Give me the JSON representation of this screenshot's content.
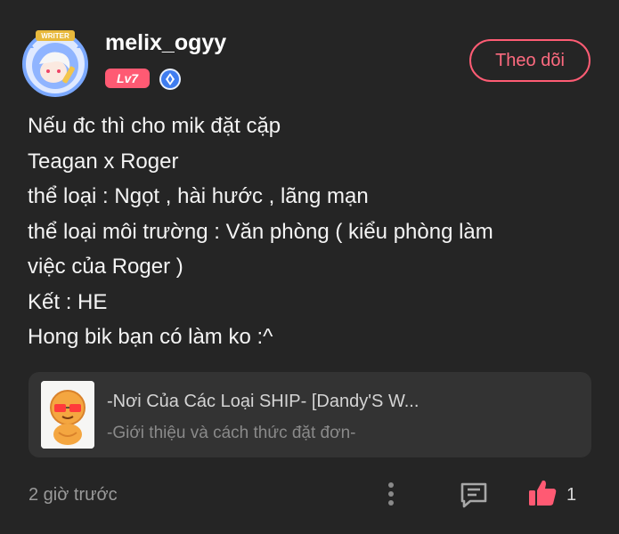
{
  "post": {
    "author": {
      "username": "melix_ogyy",
      "level": "Lv7",
      "avatar_icon": "writer-avatar",
      "badge_icon": "verified-badge-icon",
      "frame_label": "WRITER"
    },
    "follow_label": "Theo dõi",
    "content_lines": [
      "Nếu đc thì cho mik đặt cặp",
      "Teagan x Roger",
      "thể loại : Ngọt , hài hước , lãng mạn",
      "thể loại môi trường : Văn phòng ( kiểu phòng làm",
      "việc của Roger )",
      "Kết : HE",
      "Hong bik bạn có làm ko :^"
    ],
    "attachment": {
      "title": "-Nơi Của Các Loại SHIP- [Dandy'S W...",
      "subtitle": "-Giới thiệu và cách thức đặt đơn-",
      "thumbnail_icon": "cartoon-character-thumbnail"
    },
    "footer": {
      "timestamp": "2 giờ trước",
      "like_count": "1",
      "like_color": "#ff5a73"
    }
  },
  "colors": {
    "background": "#252525",
    "accent": "#ff5c74",
    "card": "#333333"
  }
}
